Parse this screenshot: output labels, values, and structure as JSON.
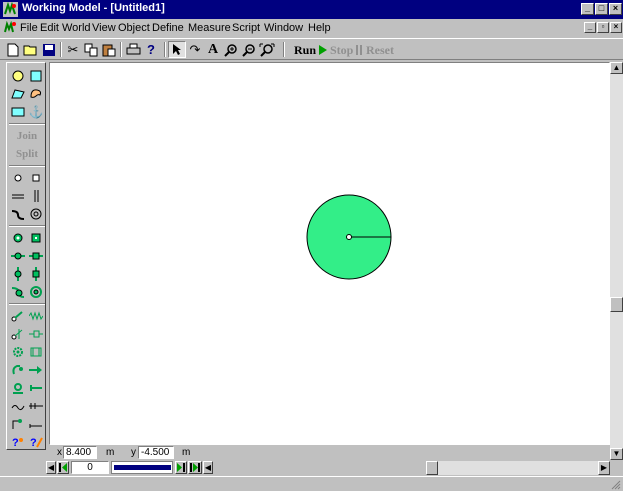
{
  "window": {
    "title": "Working Model - [Untitled1]",
    "controls": [
      "minimize",
      "maximize",
      "close"
    ]
  },
  "menu": [
    "File",
    "Edit",
    "World",
    "View",
    "Object",
    "Define",
    "Measure",
    "Script",
    "Window",
    "Help"
  ],
  "toolbar": {
    "run_label": "Run",
    "stop_label": "Stop",
    "reset_label": "Reset"
  },
  "palette": {
    "join_label": "Join",
    "split_label": "Split"
  },
  "coords": {
    "x_label": "x",
    "x_value": "8.400",
    "x_unit": "m",
    "y_label": "y",
    "y_value": "-4.500",
    "y_unit": "m"
  },
  "tape": {
    "frame_value": "0"
  },
  "colors": {
    "titlebar": "#000080",
    "body_fill": "#33ee88",
    "run_arrow": "#00a000"
  },
  "icons": {
    "app": "working-model-logo",
    "toolbar": [
      "new-icon",
      "open-icon",
      "save-icon",
      "cut-icon",
      "copy-icon",
      "paste-icon",
      "print-icon",
      "help-icon",
      "pointer-icon",
      "rotate-icon",
      "text-icon",
      "zoom-in-icon",
      "zoom-out-icon",
      "zoom-fit-icon"
    ]
  }
}
